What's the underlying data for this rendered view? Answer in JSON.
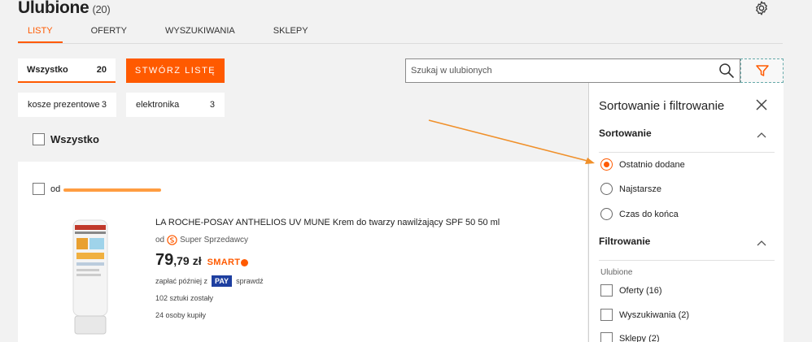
{
  "header": {
    "title": "Ulubione",
    "count": "(20)",
    "tabs": [
      {
        "label": "LISTY"
      },
      {
        "label": "OFERTY"
      },
      {
        "label": "WYSZUKIWANIA"
      },
      {
        "label": "SKLEPY"
      }
    ]
  },
  "lists": {
    "all_label": "Wszystko",
    "all_count": "20",
    "create_label": "STWÓRZ LISTĘ",
    "chips": [
      {
        "label": "kosze prezentowe",
        "count": "3"
      },
      {
        "label": "elektronika",
        "count": "3"
      }
    ],
    "select_all_label": "Wszystko"
  },
  "search": {
    "placeholder": "Szukaj w ulubionych",
    "value": ""
  },
  "product": {
    "seller_prefix": "od",
    "title": "LA ROCHE-POSAY ANTHELIOS UV MUNE Krem do twarzy nawilżający SPF 50 50 ml",
    "seller_by": "od",
    "seller_label": "Super Sprzedawcy",
    "price_int": "79",
    "price_dec": ",79",
    "currency": "zł",
    "smart_label": "SMART",
    "pay_prefix": "zapłać później z",
    "pay_badge": "PAY",
    "pay_suffix": "sprawdź",
    "stock": "102 sztuki zostały",
    "bought": "24 osoby kupiły"
  },
  "panel": {
    "title": "Sortowanie i filtrowanie",
    "sort_title": "Sortowanie",
    "sort_options": [
      {
        "label": "Ostatnio dodane",
        "selected": true
      },
      {
        "label": "Najstarsze",
        "selected": false
      },
      {
        "label": "Czas do końca",
        "selected": false
      }
    ],
    "filter_title": "Filtrowanie",
    "filter_sub": "Ulubione",
    "filter_options": [
      {
        "label": "Oferty (16)"
      },
      {
        "label": "Wyszukiwania (2)"
      },
      {
        "label": "Sklepy (2)"
      }
    ]
  },
  "colors": {
    "accent": "#ff5a00",
    "pay_blue": "#1e3fa0",
    "annotation_arrow": "#f0902a"
  },
  "icons": {
    "settings": "gear-icon",
    "search": "search-icon",
    "filter": "funnel-icon",
    "close": "close-icon",
    "collapse": "chevron-up-icon",
    "seller_badge": "super-seller-icon"
  }
}
